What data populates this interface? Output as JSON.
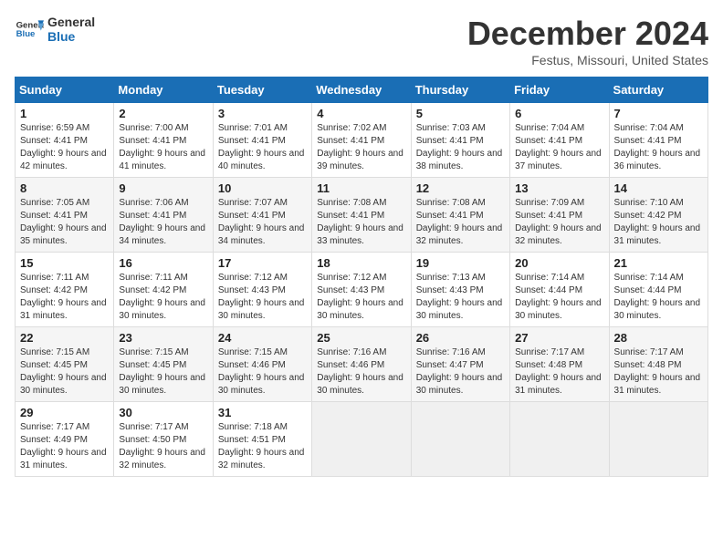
{
  "header": {
    "logo_line1": "General",
    "logo_line2": "Blue",
    "title": "December 2024",
    "subtitle": "Festus, Missouri, United States"
  },
  "weekdays": [
    "Sunday",
    "Monday",
    "Tuesday",
    "Wednesday",
    "Thursday",
    "Friday",
    "Saturday"
  ],
  "weeks": [
    [
      {
        "day": "1",
        "sunrise": "6:59 AM",
        "sunset": "4:41 PM",
        "daylight": "9 hours and 42 minutes."
      },
      {
        "day": "2",
        "sunrise": "7:00 AM",
        "sunset": "4:41 PM",
        "daylight": "9 hours and 41 minutes."
      },
      {
        "day": "3",
        "sunrise": "7:01 AM",
        "sunset": "4:41 PM",
        "daylight": "9 hours and 40 minutes."
      },
      {
        "day": "4",
        "sunrise": "7:02 AM",
        "sunset": "4:41 PM",
        "daylight": "9 hours and 39 minutes."
      },
      {
        "day": "5",
        "sunrise": "7:03 AM",
        "sunset": "4:41 PM",
        "daylight": "9 hours and 38 minutes."
      },
      {
        "day": "6",
        "sunrise": "7:04 AM",
        "sunset": "4:41 PM",
        "daylight": "9 hours and 37 minutes."
      },
      {
        "day": "7",
        "sunrise": "7:04 AM",
        "sunset": "4:41 PM",
        "daylight": "9 hours and 36 minutes."
      }
    ],
    [
      {
        "day": "8",
        "sunrise": "7:05 AM",
        "sunset": "4:41 PM",
        "daylight": "9 hours and 35 minutes."
      },
      {
        "day": "9",
        "sunrise": "7:06 AM",
        "sunset": "4:41 PM",
        "daylight": "9 hours and 34 minutes."
      },
      {
        "day": "10",
        "sunrise": "7:07 AM",
        "sunset": "4:41 PM",
        "daylight": "9 hours and 34 minutes."
      },
      {
        "day": "11",
        "sunrise": "7:08 AM",
        "sunset": "4:41 PM",
        "daylight": "9 hours and 33 minutes."
      },
      {
        "day": "12",
        "sunrise": "7:08 AM",
        "sunset": "4:41 PM",
        "daylight": "9 hours and 32 minutes."
      },
      {
        "day": "13",
        "sunrise": "7:09 AM",
        "sunset": "4:41 PM",
        "daylight": "9 hours and 32 minutes."
      },
      {
        "day": "14",
        "sunrise": "7:10 AM",
        "sunset": "4:42 PM",
        "daylight": "9 hours and 31 minutes."
      }
    ],
    [
      {
        "day": "15",
        "sunrise": "7:11 AM",
        "sunset": "4:42 PM",
        "daylight": "9 hours and 31 minutes."
      },
      {
        "day": "16",
        "sunrise": "7:11 AM",
        "sunset": "4:42 PM",
        "daylight": "9 hours and 30 minutes."
      },
      {
        "day": "17",
        "sunrise": "7:12 AM",
        "sunset": "4:43 PM",
        "daylight": "9 hours and 30 minutes."
      },
      {
        "day": "18",
        "sunrise": "7:12 AM",
        "sunset": "4:43 PM",
        "daylight": "9 hours and 30 minutes."
      },
      {
        "day": "19",
        "sunrise": "7:13 AM",
        "sunset": "4:43 PM",
        "daylight": "9 hours and 30 minutes."
      },
      {
        "day": "20",
        "sunrise": "7:14 AM",
        "sunset": "4:44 PM",
        "daylight": "9 hours and 30 minutes."
      },
      {
        "day": "21",
        "sunrise": "7:14 AM",
        "sunset": "4:44 PM",
        "daylight": "9 hours and 30 minutes."
      }
    ],
    [
      {
        "day": "22",
        "sunrise": "7:15 AM",
        "sunset": "4:45 PM",
        "daylight": "9 hours and 30 minutes."
      },
      {
        "day": "23",
        "sunrise": "7:15 AM",
        "sunset": "4:45 PM",
        "daylight": "9 hours and 30 minutes."
      },
      {
        "day": "24",
        "sunrise": "7:15 AM",
        "sunset": "4:46 PM",
        "daylight": "9 hours and 30 minutes."
      },
      {
        "day": "25",
        "sunrise": "7:16 AM",
        "sunset": "4:46 PM",
        "daylight": "9 hours and 30 minutes."
      },
      {
        "day": "26",
        "sunrise": "7:16 AM",
        "sunset": "4:47 PM",
        "daylight": "9 hours and 30 minutes."
      },
      {
        "day": "27",
        "sunrise": "7:17 AM",
        "sunset": "4:48 PM",
        "daylight": "9 hours and 31 minutes."
      },
      {
        "day": "28",
        "sunrise": "7:17 AM",
        "sunset": "4:48 PM",
        "daylight": "9 hours and 31 minutes."
      }
    ],
    [
      {
        "day": "29",
        "sunrise": "7:17 AM",
        "sunset": "4:49 PM",
        "daylight": "9 hours and 31 minutes."
      },
      {
        "day": "30",
        "sunrise": "7:17 AM",
        "sunset": "4:50 PM",
        "daylight": "9 hours and 32 minutes."
      },
      {
        "day": "31",
        "sunrise": "7:18 AM",
        "sunset": "4:51 PM",
        "daylight": "9 hours and 32 minutes."
      },
      null,
      null,
      null,
      null
    ]
  ]
}
